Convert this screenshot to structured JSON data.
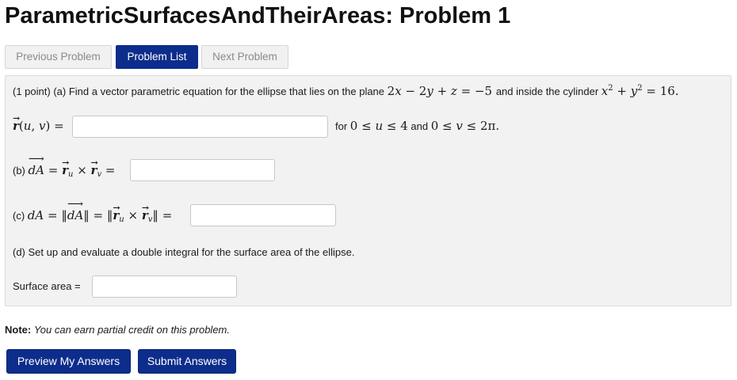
{
  "title": "ParametricSurfacesAndTheirAreas: Problem 1",
  "nav": {
    "previous_label": "Previous Problem",
    "list_label": "Problem List",
    "next_label": "Next Problem"
  },
  "problem": {
    "points": "(1 point)",
    "part_a_label": "(a)",
    "part_a_text_1": "Find a vector parametric equation for the ellipse that lies on the plane",
    "part_a_text_2": "and inside the cylinder",
    "plane_equation": "2x − 2y + z = −5",
    "cylinder_equation": "x² + y² = 16",
    "r_lhs": "r(u, v) =",
    "domain_prefix": "for",
    "u_range": "0 ≤ u ≤ 4",
    "domain_and": "and",
    "v_range": "0 ≤ v ≤ 2π",
    "part_b_label": "(b)",
    "part_b_expr": "dA = r_u × r_v =",
    "part_c_label": "(c)",
    "part_c_expr": "dA = ||dA|| = ||r_u × r_v|| =",
    "part_d_text": "(d) Set up and evaluate a double integral for the surface area of the ellipse.",
    "surface_area_label": "Surface area ="
  },
  "inputs": {
    "r_value": "",
    "dA_vector_value": "",
    "dA_value": "",
    "surface_area_value": ""
  },
  "note": {
    "label": "Note:",
    "text": "You can earn partial credit on this problem."
  },
  "buttons": {
    "preview_label": "Preview My Answers",
    "submit_label": "Submit Answers"
  },
  "colors": {
    "accent": "#0d2d8c",
    "panel_bg": "#f2f2f2",
    "disabled_bg": "#f1f1f1"
  }
}
